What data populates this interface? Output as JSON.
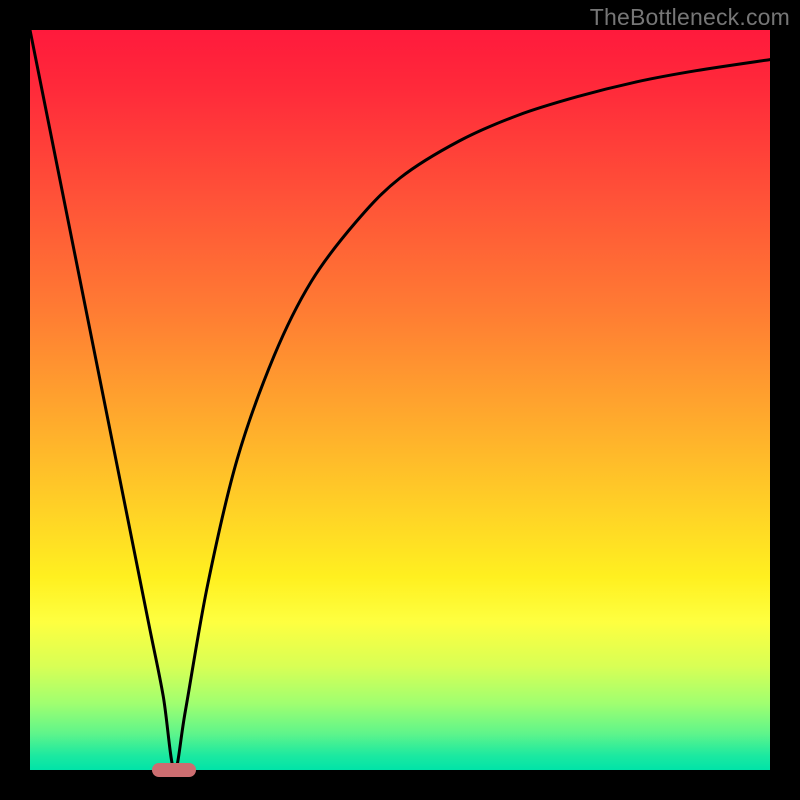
{
  "watermark": "TheBottleneck.com",
  "chart_data": {
    "type": "line",
    "title": "",
    "xlabel": "",
    "ylabel": "",
    "xlim": [
      0,
      100
    ],
    "ylim": [
      0,
      100
    ],
    "grid": false,
    "legend": false,
    "series": [
      {
        "name": "bottleneck-curve",
        "x": [
          0,
          6,
          12,
          16,
          18,
          19.5,
          21,
          24,
          28,
          33,
          38,
          44,
          50,
          58,
          66,
          74,
          82,
          90,
          100
        ],
        "values": [
          100,
          70,
          40,
          20,
          10,
          0,
          8,
          25,
          42,
          56,
          66,
          74,
          80,
          85,
          88.5,
          91,
          93,
          94.5,
          96
        ]
      }
    ],
    "annotations": {
      "optimal_marker": {
        "x_center": 19.5,
        "y": 0,
        "width_pct": 6
      }
    },
    "background_gradient": {
      "top": "#ff1a3c",
      "bottom": "#00e3a8"
    }
  }
}
